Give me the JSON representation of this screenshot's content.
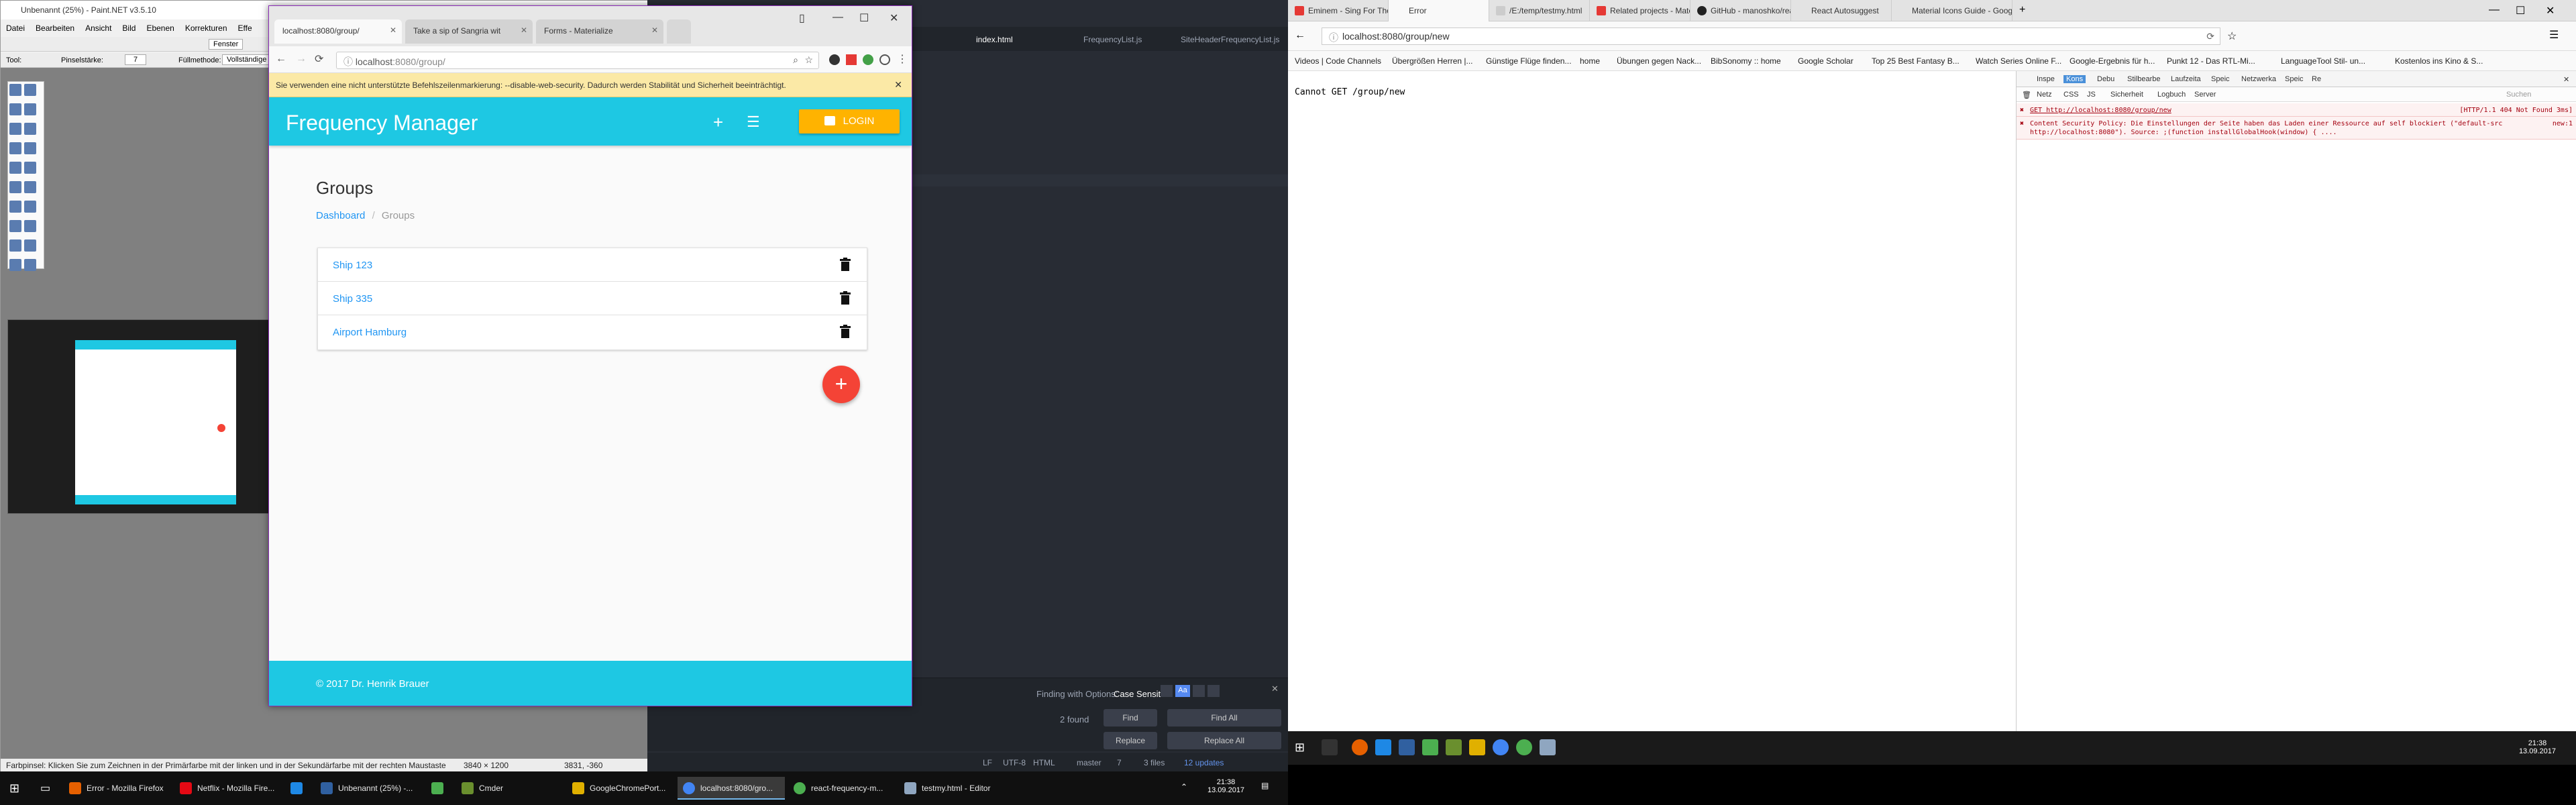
{
  "paint": {
    "title": "Unbenannt (25%) - Paint.NET v3.5.10",
    "menu": [
      "Datei",
      "Bearbeiten",
      "Ansicht",
      "Bild",
      "Ebenen",
      "Korrekturen",
      "Effe"
    ],
    "toolbar": {
      "tool_label": "Tool:",
      "brush_label": "Pinselstärke:",
      "brush_value": "7",
      "fill_label": "Füllmethode:",
      "fill_value": "Vollständige",
      "window_select": "Fenster"
    },
    "status_hint": "Farbpinsel: Klicken Sie zum Zeichnen in der Primärfarbe mit der linken und in der Sekundärfarbe mit der rechten Maustaste",
    "status_size": "3840 × 1200",
    "status_coords": "3831, -360"
  },
  "editor": {
    "tabs": [
      "index.html",
      "FrequencyList.js",
      "SiteHeaderFrequencyList.js"
    ],
    "find": {
      "options_label": "Finding with Options:",
      "options_value": "Case Sensitive",
      "found": "2 found",
      "find": "Find",
      "find_all": "Find All",
      "replace": "Replace",
      "replace_all": "Replace All"
    },
    "status": {
      "lf": "LF",
      "encoding": "UTF-8",
      "grammar": "HTML",
      "branch": "master",
      "changes": "7",
      "files": "3 files",
      "updates": "12 updates"
    }
  },
  "chrome": {
    "tabs": [
      {
        "label": "localhost:8080/group/",
        "active": true
      },
      {
        "label": "Take a sip of Sangria wit",
        "active": false
      },
      {
        "label": "Forms - Materialize",
        "active": false
      }
    ],
    "url_host": "localhost",
    "url_path": ":8080/group/",
    "infobar": "Sie verwenden eine nicht unterstützte Befehlszeilenmarkierung: --disable-web-security. Dadurch werden Stabilität und Sicherheit beeinträchtigt.",
    "app": {
      "brand": "Frequency Manager",
      "add_icon": "+",
      "list_icon": "☰",
      "login": "LOGIN",
      "heading": "Groups",
      "breadcrumb": {
        "home": "Dashboard",
        "separator": "/",
        "current": "Groups"
      },
      "groups": [
        "Ship 123",
        "Ship 335",
        "Airport Hamburg"
      ],
      "fab": "+",
      "footer": "© 2017 Dr. Henrik Brauer",
      "primary_color": "#1ec8e3",
      "login_color": "#ffb300",
      "fab_color": "#f44336"
    }
  },
  "left_taskbar": [
    {
      "label": "Error - Mozilla Firefox",
      "color": "#e66000"
    },
    {
      "label": "Netflix - Mozilla Fire...",
      "color": "#e50914"
    },
    {
      "label": "",
      "color": "#1e88e5"
    },
    {
      "label": "Unbenannt (25%) -...",
      "color": "#3060a0"
    },
    {
      "label": "",
      "color": "#4caf50"
    },
    {
      "label": "Cmder",
      "color": "#6a8f2e"
    },
    {
      "label": "GoogleChromePort...",
      "color": "#e0b000"
    },
    {
      "label": "localhost:8080/gro...",
      "color": "#4285f4"
    },
    {
      "label": "react-frequency-m...",
      "color": "#4caf50"
    },
    {
      "label": "testmy.html - Editor",
      "color": "#8fa6c0"
    }
  ],
  "left_clock": {
    "time": "21:38",
    "date": "13.09.2017"
  },
  "firefox": {
    "tabs": [
      "Eminem - Sing For The Mo",
      "Error",
      "/E:/temp/testmy.html",
      "Related projects - Materi",
      "GitHub - manoshko/react-",
      "React Autosuggest",
      "Material Icons Guide - Google"
    ],
    "url": "localhost:8080/group/new",
    "bookmarks": [
      "Videos | Code Channels",
      "Übergrößen Herren |...",
      "Günstige Flüge finden...",
      "home",
      "Übungen gegen Nack...",
      "BibSonomy :: home",
      "Google Scholar",
      "Top 25 Best Fantasy B...",
      "Watch Series Online F...",
      "Google-Ergebnis für h...",
      "Punkt 12 - Das RTL-Mi...",
      "LanguageTool Stil- un...",
      "Kostenlos ins Kino & S..."
    ],
    "page_text": "Cannot GET /group/new",
    "devtools": {
      "tabs": [
        "Inspe",
        "Kons",
        "Debu",
        "Stilbearbe",
        "Laufzeita",
        "Speic",
        "Netzwerka",
        "Speic",
        "Re"
      ],
      "filters": [
        "Netz",
        "CSS",
        "JS",
        "Sicherheit",
        "Logbuch",
        "Server"
      ],
      "search_placeholder": "Suchen",
      "errors": [
        {
          "text": "GET http://localhost:8080/group/new",
          "source": "[HTTP/1.1 404 Not Found 3ms]"
        },
        {
          "text": "Content Security Policy: Die Einstellungen der Seite haben das Laden einer Ressource auf self blockiert (\"default-src http://localhost:8080\"). Source: ;(function installGlobalHook(window) { ....",
          "source": "new:1"
        }
      ]
    }
  },
  "right_clock": {
    "time": "21:38",
    "date": "13.09.2017"
  }
}
